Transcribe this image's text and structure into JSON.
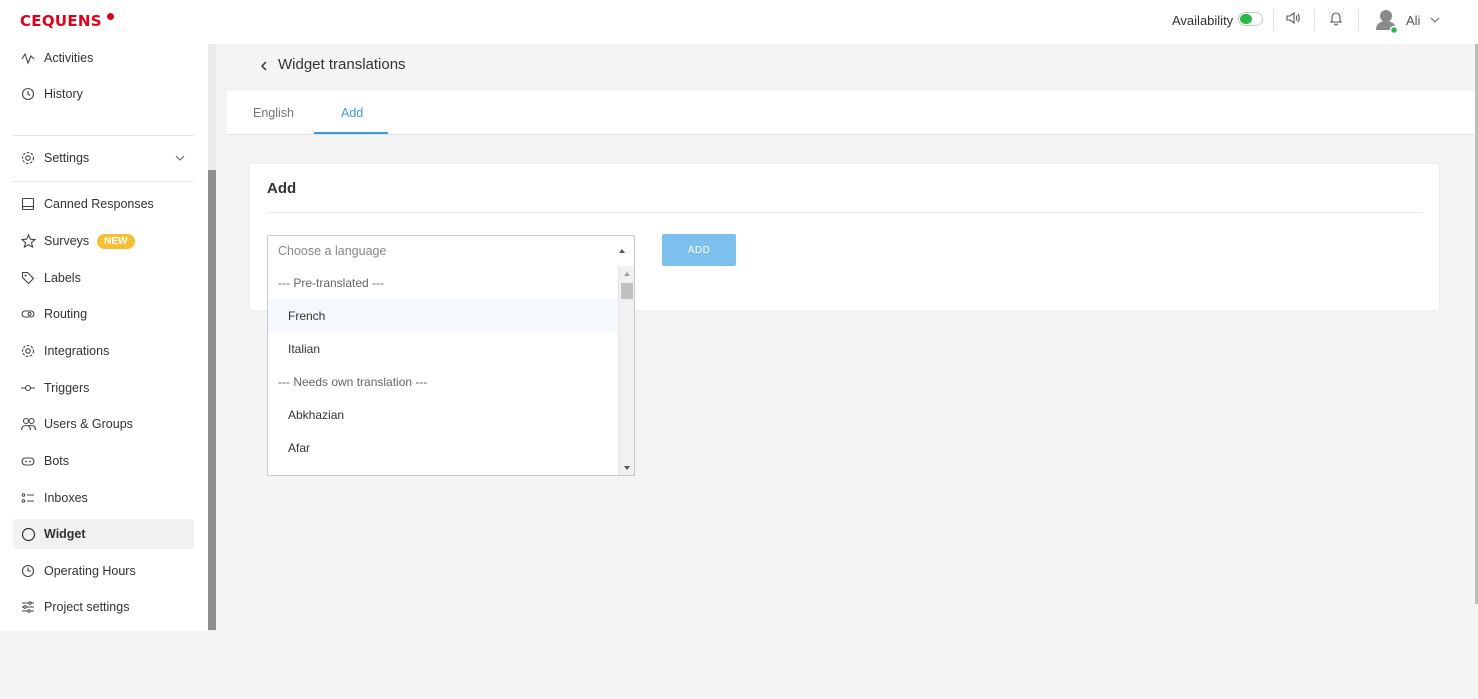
{
  "brand": {
    "logo_text": "CEQUENS",
    "accent": "#e0001b"
  },
  "topbar": {
    "availability_label": "Availability",
    "availability_on": true,
    "user_name": "Ali"
  },
  "sidebar": {
    "items": [
      {
        "label": "Activities",
        "icon": "activity-icon"
      },
      {
        "label": "History",
        "icon": "history-icon"
      },
      {
        "label": "Settings",
        "icon": "gear-icon"
      },
      {
        "label": "Canned Responses",
        "icon": "note-icon"
      },
      {
        "label": "Surveys",
        "icon": "star-icon",
        "badge": "NEW"
      },
      {
        "label": "Labels",
        "icon": "tag-icon"
      },
      {
        "label": "Routing",
        "icon": "routing-icon"
      },
      {
        "label": "Integrations",
        "icon": "integrations-icon"
      },
      {
        "label": "Triggers",
        "icon": "trigger-icon"
      },
      {
        "label": "Users & Groups",
        "icon": "users-icon"
      },
      {
        "label": "Bots",
        "icon": "bot-icon"
      },
      {
        "label": "Inboxes",
        "icon": "inbox-icon"
      },
      {
        "label": "Widget",
        "icon": "widget-icon",
        "active": true
      },
      {
        "label": "Operating Hours",
        "icon": "clock-icon"
      },
      {
        "label": "Project settings",
        "icon": "sliders-icon"
      }
    ]
  },
  "page": {
    "title": "Widget translations",
    "tabs": [
      {
        "label": "English",
        "active": false
      },
      {
        "label": "Add",
        "active": true
      }
    ],
    "card_title": "Add",
    "select_placeholder": "Choose a language",
    "add_button": "ADD",
    "dropdown_options": [
      {
        "label": "--- Pre-translated ---",
        "type": "group"
      },
      {
        "label": "French",
        "type": "item",
        "hover": true
      },
      {
        "label": "Italian",
        "type": "item"
      },
      {
        "label": "--- Needs own translation ---",
        "type": "group"
      },
      {
        "label": "Abkhazian",
        "type": "item"
      },
      {
        "label": "Afar",
        "type": "item"
      }
    ]
  },
  "colors": {
    "primary": "#3d9bdc",
    "button": "#7dc0ee",
    "toggle_on": "#2db84b",
    "badge": "#f7c034"
  }
}
